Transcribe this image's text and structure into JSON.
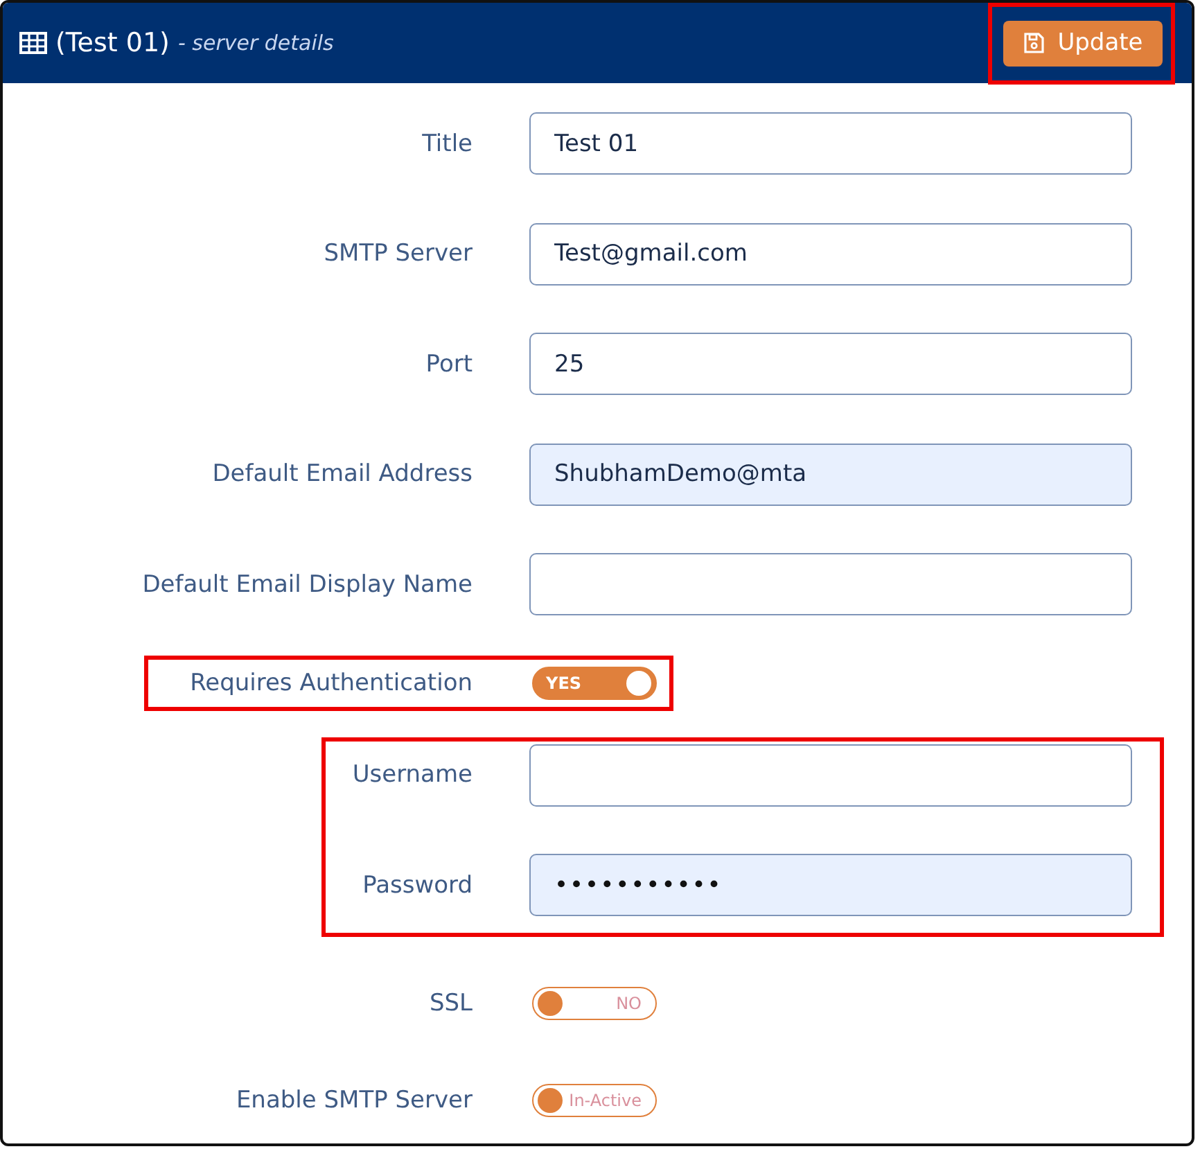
{
  "header": {
    "title": "(Test 01)",
    "subtitle": "- server details",
    "update_button": {
      "label": "Update",
      "highlighted": true
    }
  },
  "fields": [
    {
      "label": "Title",
      "value": "Test 01",
      "autofilled": false
    },
    {
      "label": "SMTP Server",
      "value": "Test@gmail.com",
      "autofilled": false
    },
    {
      "label": "Port",
      "value": "25",
      "autofilled": false
    },
    {
      "label": "Default Email Address",
      "value": "ShubhamDemo@mta",
      "autofilled": true
    },
    {
      "label": "Default Email Display Name",
      "autofilled": false
    }
  ],
  "authentication": {
    "label": "Requires Authentication",
    "on": true,
    "state_text": "YES",
    "highlighted": true
  },
  "credentials": {
    "highlighted": true,
    "fields": [
      {
        "label": "Username",
        "autofilled": false
      },
      {
        "label": "Password",
        "kind": "password",
        "value": "•••••••••••",
        "autofilled": true
      }
    ]
  },
  "options": [
    {
      "label": "SSL",
      "on": false,
      "state_text": "NO"
    },
    {
      "label": "Enable SMTP Server",
      "on": false,
      "state_text": "In-Active"
    }
  ]
}
